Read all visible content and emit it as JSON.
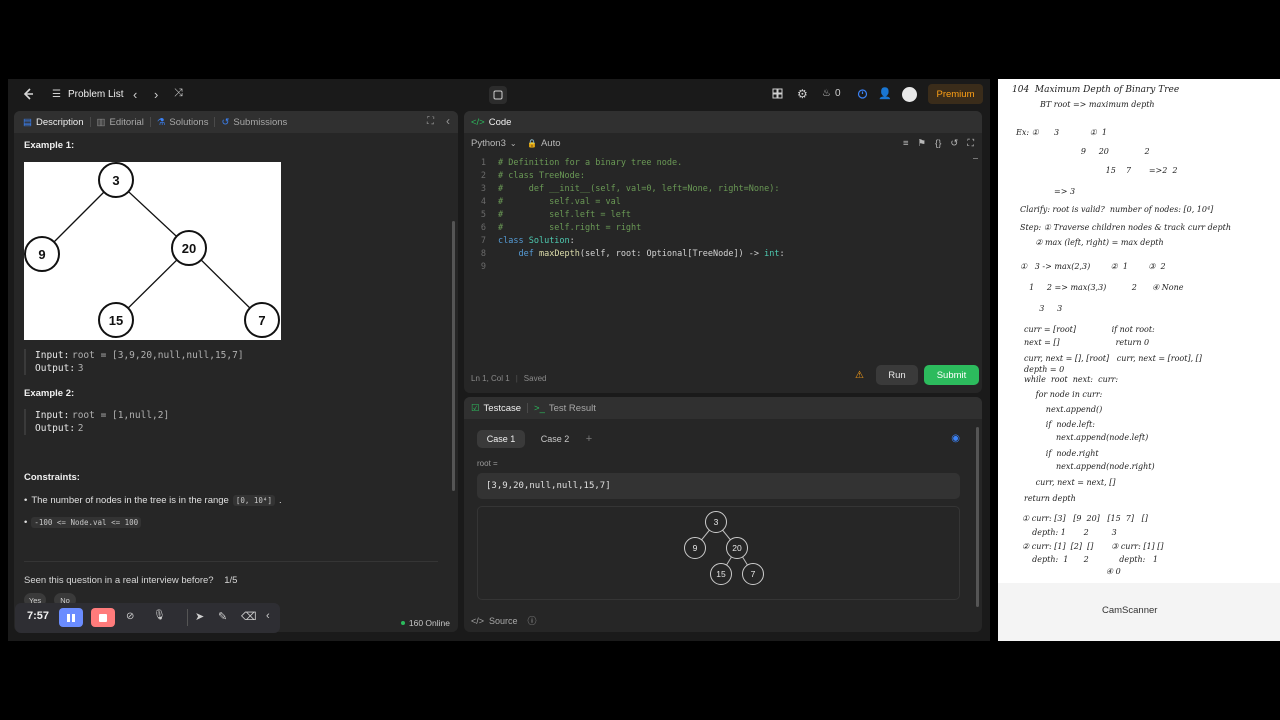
{
  "topbar": {
    "problem_list": "Problem List",
    "streak": "0",
    "premium": "Premium"
  },
  "description": {
    "tabs": [
      "Description",
      "Editorial",
      "Solutions",
      "Submissions"
    ],
    "example1_title": "Example 1:",
    "example1_tree": [
      "3",
      "9",
      "20",
      "15",
      "7"
    ],
    "example1_input_key": "Input:",
    "example1_input_val": "root = [3,9,20,null,null,15,7]",
    "example1_output_key": "Output:",
    "example1_output_val": "3",
    "example2_title": "Example 2:",
    "example2_input_key": "Input:",
    "example2_input_val": "root = [1,null,2]",
    "example2_output_key": "Output:",
    "example2_output_val": "2",
    "constraints_title": "Constraints:",
    "constraint1_text": "The number of nodes in the tree is in the range",
    "constraint1_code": "[0, 10⁴]",
    "constraint1_end": ".",
    "constraint2_code": "-100 <= Node.val <= 100",
    "seen_question": "Seen this question in a real interview before?",
    "seen_count": "1/5",
    "yes": "Yes",
    "no": "No",
    "online": "160 Online"
  },
  "code": {
    "tab": "Code",
    "language": "Python3",
    "auto": "Auto",
    "lines": [
      "# Definition for a binary tree node.",
      "# class TreeNode:",
      "#     def __init__(self, val=0, left=None, right=None):",
      "#         self.val = val",
      "#         self.left = left",
      "#         self.right = right",
      "class Solution:",
      "    def maxDepth(self, root: Optional[TreeNode]) -> int:",
      ""
    ],
    "status_pos": "Ln 1, Col 1",
    "status_saved": "Saved",
    "run": "Run",
    "submit": "Submit"
  },
  "testcase": {
    "tab_testcase": "Testcase",
    "tab_result": "Test Result",
    "case1": "Case 1",
    "case2": "Case 2",
    "add": "+",
    "root_label": "root =",
    "root_value": "[3,9,20,null,null,15,7]",
    "tree": [
      "3",
      "9",
      "20",
      "15",
      "7"
    ],
    "source": "Source"
  },
  "recorder": {
    "time": "7:57"
  },
  "notes": {
    "watermark": "CamScanner",
    "lines": [
      "104  Maximum Depth of Binary Tree",
      "BT root => maximum depth",
      "Ex: ①      3            ①  1",
      "         9     20              2",
      "              15    7       =>2  2",
      "=> 3",
      "Clarify: root is valid?  number of nodes: [0, 10⁴]",
      "Step: ① Traverse children nodes & track curr depth",
      "      ② max (left, right) = max depth",
      "①   3 -> max(2,3)        ②  1        ③  2",
      "  1     2 => max(3,3)          2      ④ None",
      "      3     3",
      "curr = [root]              if not root:",
      "next = []                      return 0",
      "curr, next = [], [root]   curr, next = [root], []",
      "depth = 0",
      "while  root  next:  curr:",
      "   for node in curr:",
      "       next.append()",
      "       if  node.left:",
      "           next.append(node.left)",
      "       if  node.right",
      "           next.append(node.right)",
      "   curr, next = next, []",
      "return depth",
      "① curr: [3]   [9  20]   [15  7]   []",
      "    depth: 1       2         3",
      "② curr: [1]  [2]  []       ③ curr: [1] []",
      "    depth:  1      2            depth:   1",
      "                                 ④ 0"
    ]
  }
}
